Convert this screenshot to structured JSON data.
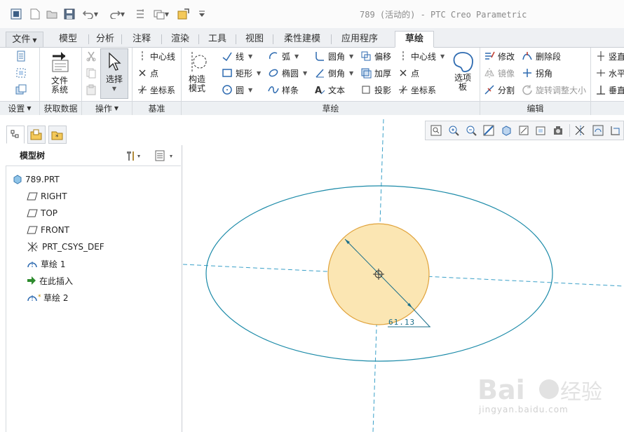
{
  "window": {
    "title": "789 (活动的) - PTC Creo Parametric"
  },
  "tabs": [
    {
      "label": "文件"
    },
    {
      "label": "模型"
    },
    {
      "label": "分析"
    },
    {
      "label": "注释"
    },
    {
      "label": "渲染"
    },
    {
      "label": "工具"
    },
    {
      "label": "视图"
    },
    {
      "label": "柔性建模"
    },
    {
      "label": "应用程序"
    },
    {
      "label": "草绘"
    }
  ],
  "ribbon": {
    "setup": {
      "group_label": "设置"
    },
    "get_data": {
      "file_system_label": "文件系统",
      "group_label": "获取数据"
    },
    "operations": {
      "select_label": "选择",
      "group_label": "操作"
    },
    "datum": {
      "centerline": "中心线",
      "point": "点",
      "csys": "坐标系",
      "group_label": "基准"
    },
    "sketching": {
      "construction_mode": "构造模式",
      "line": "线",
      "rectangle": "矩形",
      "circle": "圆",
      "arc": "弧",
      "ellipse": "椭圆",
      "spline": "样条",
      "fillet": "圆角",
      "chamfer": "倒角",
      "text": "文本",
      "offset": "偏移",
      "thicken": "加厚",
      "project": "投影",
      "centerline": "中心线",
      "point": "点",
      "csys": "坐标系",
      "palette": "选项板",
      "group_label": "草绘"
    },
    "editing": {
      "modify": "修改",
      "delete_segment": "删除段",
      "mirror": "镜像",
      "corner": "拐角",
      "divide": "分割",
      "rotate_resize": "旋转调整大小",
      "group_label": "编辑"
    },
    "constrain": {
      "vertical": "竖直",
      "horizontal": "水平",
      "perpendicular": "垂直"
    }
  },
  "model_tree": {
    "title": "模型树",
    "items": [
      {
        "label": "789.PRT",
        "icon": "part-icon"
      },
      {
        "label": "RIGHT",
        "icon": "datum-plane-icon"
      },
      {
        "label": "TOP",
        "icon": "datum-plane-icon"
      },
      {
        "label": "FRONT",
        "icon": "datum-plane-icon"
      },
      {
        "label": "PRT_CSYS_DEF",
        "icon": "csys-icon"
      },
      {
        "label": "草绘 1",
        "icon": "sketch-icon"
      },
      {
        "label": "在此插入",
        "icon": "insert-here-arrow-icon"
      },
      {
        "label": "草绘 2",
        "icon": "sketch-active-icon"
      }
    ]
  },
  "graphics": {
    "dimension_label": "61.13",
    "watermark_text": "jingyan.baidu.com",
    "colors": {
      "sketch_line": "#1b8aa8",
      "centerline": "#3aa0c8",
      "circle_fill": "#fbe6b3",
      "circle_stroke": "#e0a33c"
    }
  }
}
